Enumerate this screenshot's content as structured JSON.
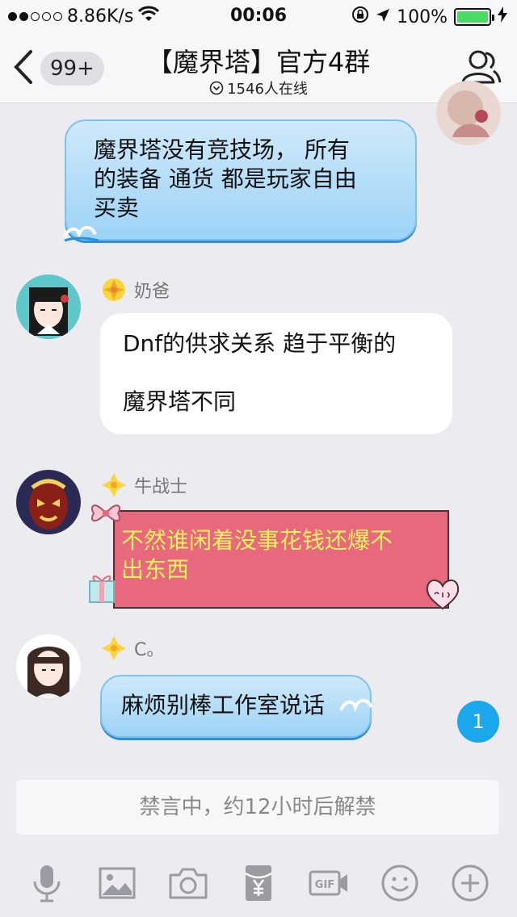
{
  "status_bar": {
    "network_speed": "8.86K/s",
    "time": "00:06",
    "battery_percent": "100%",
    "signal_bars_filled": 2,
    "signal_bars_total": 5
  },
  "header": {
    "back_badge": "99+",
    "title": "【魔界塔】官方4群",
    "online_count": "1546人在线"
  },
  "messages": [
    {
      "side": "right",
      "text_lines": [
        "魔界塔没有竞技场， 所有",
        "的装备 通货 都是玩家自由",
        "买卖"
      ]
    },
    {
      "side": "left",
      "sender": "奶爸",
      "text_lines": [
        "Dnf的供求关系 趋于平衡的",
        "",
        "魔界塔不同"
      ]
    },
    {
      "side": "left",
      "sender": "牛战士",
      "text_lines": [
        "不然谁闲着没事花钱还爆不",
        "出东西"
      ]
    },
    {
      "side": "left",
      "sender": "C。",
      "text_lines": [
        "麻烦别棒工作室说话"
      ]
    }
  ],
  "unread_badge": "1",
  "input": {
    "muted_text": "禁言中，约12小时后解禁"
  },
  "toolbar": {
    "gif_label": "GIF",
    "icons": [
      "microphone-icon",
      "image-icon",
      "camera-icon",
      "red-packet-icon",
      "gif-icon",
      "emoji-icon",
      "plus-icon"
    ]
  },
  "colors": {
    "accent_blue": "#1aa7ec",
    "bubble_blue": "#9dd3f6",
    "bubble_pink": "#e8687e",
    "pink_text": "#fff35c",
    "battery_green": "#4cd964"
  }
}
